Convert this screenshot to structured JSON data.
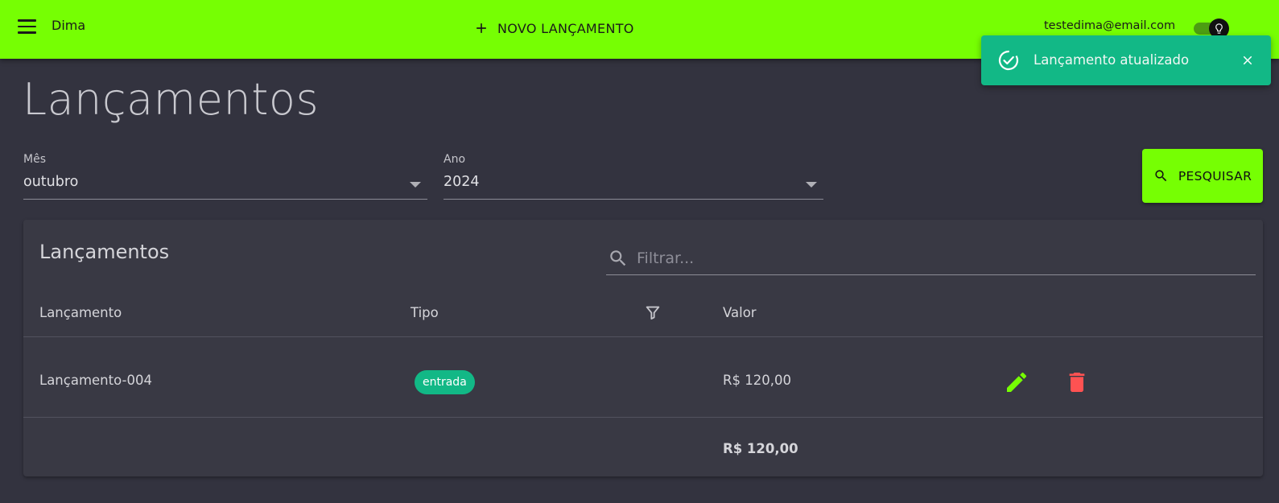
{
  "header": {
    "user_name": "Dima",
    "new_entry_label": "NOVO LANÇAMENTO",
    "email": "testedima@email.com"
  },
  "snackbar": {
    "message": "Lançamento atualizado"
  },
  "page": {
    "title": "Lançamentos"
  },
  "filters": {
    "month_label": "Mês",
    "month_value": "outubro",
    "year_label": "Ano",
    "year_value": "2024",
    "search_label": "PESQUISAR"
  },
  "table": {
    "title": "Lançamentos",
    "filter_placeholder": "Filtrar...",
    "columns": [
      "Lançamento",
      "Tipo",
      "Valor"
    ],
    "rows": [
      {
        "name": "Lançamento-004",
        "type": "entrada",
        "value": "R$ 120,00"
      }
    ],
    "total": "R$ 120,00"
  },
  "colors": {
    "accent": "#76ff03",
    "success": "#12b886",
    "danger": "#ff5252",
    "background": "#33333f",
    "card": "#393944"
  }
}
